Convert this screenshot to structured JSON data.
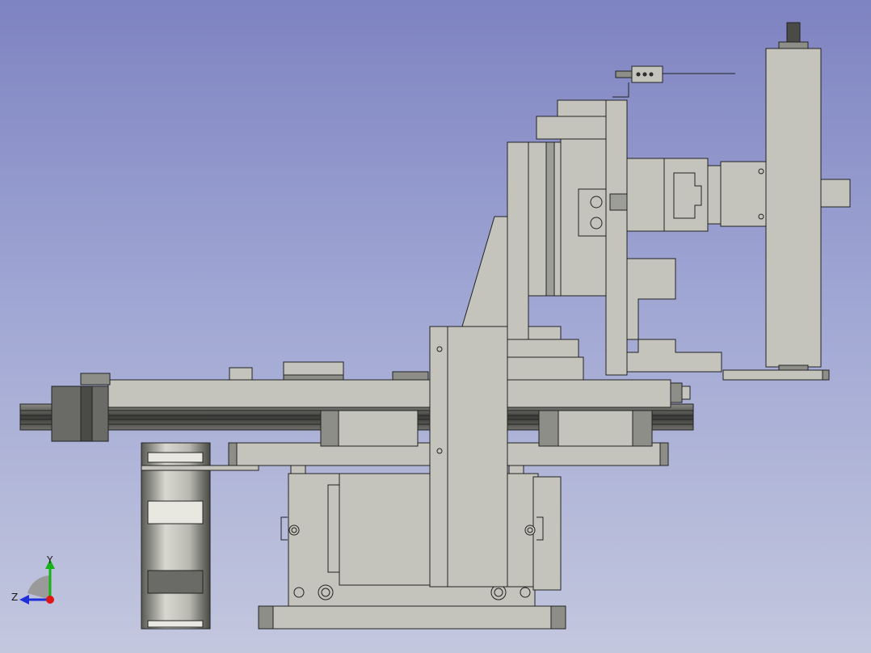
{
  "viewer": {
    "background_top": "#7e83c1",
    "background_bottom": "#c3c7de",
    "part_fill": "#c4c4bc",
    "part_edge": "#222222"
  },
  "axis_triad": {
    "y_label": "Y",
    "z_label": "Z",
    "y_color": "#16b316",
    "z_color": "#1f2fd8",
    "x_color": "#e01616"
  }
}
